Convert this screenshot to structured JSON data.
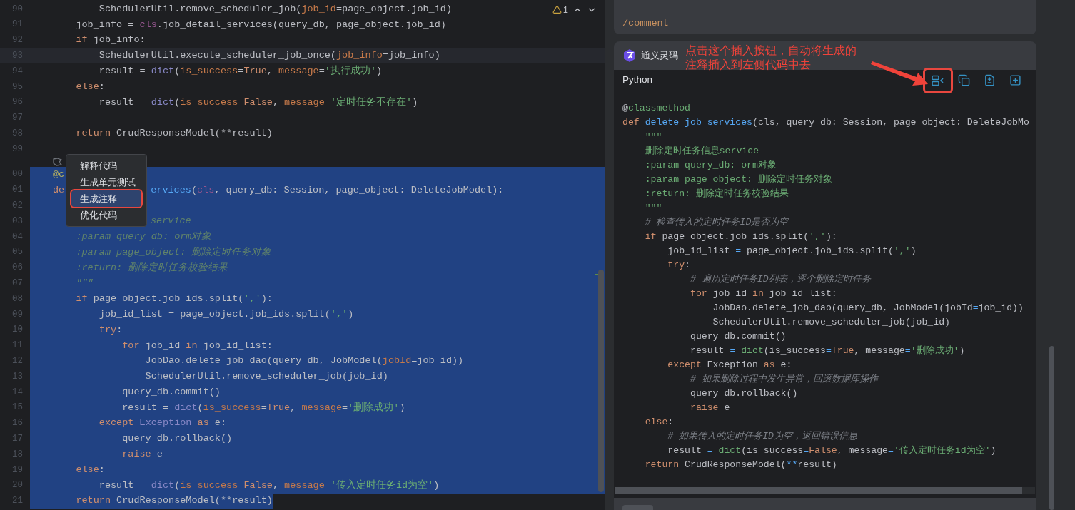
{
  "editor": {
    "warning_count": "1",
    "context_menu": {
      "items": [
        {
          "label": "解释代码",
          "selected": false,
          "annotated": false
        },
        {
          "label": "生成单元测试",
          "selected": false,
          "annotated": false
        },
        {
          "label": "生成注释",
          "selected": true,
          "annotated": true
        },
        {
          "label": "优化代码",
          "selected": false,
          "annotated": false
        }
      ]
    },
    "lines": [
      {
        "kind": "code",
        "number": "90",
        "selected": false,
        "current": false,
        "tokens": [
          {
            "text": "        SchedulerUtil.remove_scheduler_job(",
            "kind": "p"
          },
          {
            "text": "job_id",
            "kind": "kwarg"
          },
          {
            "text": "=page_object.job_id)",
            "kind": "p"
          }
        ]
      },
      {
        "kind": "code",
        "number": "91",
        "selected": false,
        "current": false,
        "tokens": [
          {
            "text": "    job_info = ",
            "kind": "p"
          },
          {
            "text": "cls",
            "kind": "self"
          },
          {
            "text": ".job_detail_services(query_db, page_object.job_id)",
            "kind": "p"
          }
        ]
      },
      {
        "kind": "code",
        "number": "92",
        "selected": false,
        "current": false,
        "tokens": [
          {
            "text": "    if",
            "kind": "kw"
          },
          {
            "text": " job_info:",
            "kind": "p"
          }
        ]
      },
      {
        "kind": "code",
        "number": "93",
        "selected": false,
        "current": true,
        "tokens": [
          {
            "text": "        SchedulerUtil.execute_scheduler_job_once(",
            "kind": "p"
          },
          {
            "text": "job_info",
            "kind": "kwarg"
          },
          {
            "text": "=job_info)",
            "kind": "p"
          }
        ]
      },
      {
        "kind": "code",
        "number": "94",
        "selected": false,
        "current": false,
        "tokens": [
          {
            "text": "        result = ",
            "kind": "p"
          },
          {
            "text": "dict",
            "kind": "bi"
          },
          {
            "text": "(",
            "kind": "p"
          },
          {
            "text": "is_success",
            "kind": "kwarg"
          },
          {
            "text": "=",
            "kind": "p"
          },
          {
            "text": "True",
            "kind": "kw"
          },
          {
            "text": ", ",
            "kind": "p"
          },
          {
            "text": "message",
            "kind": "kwarg"
          },
          {
            "text": "=",
            "kind": "p"
          },
          {
            "text": "'执行成功'",
            "kind": "str"
          },
          {
            "text": ")",
            "kind": "p"
          }
        ]
      },
      {
        "kind": "code",
        "number": "95",
        "selected": false,
        "current": false,
        "tokens": [
          {
            "text": "    else",
            "kind": "kw"
          },
          {
            "text": ":",
            "kind": "p"
          }
        ]
      },
      {
        "kind": "code",
        "number": "96",
        "selected": false,
        "current": false,
        "tokens": [
          {
            "text": "        result = ",
            "kind": "p"
          },
          {
            "text": "dict",
            "kind": "bi"
          },
          {
            "text": "(",
            "kind": "p"
          },
          {
            "text": "is_success",
            "kind": "kwarg"
          },
          {
            "text": "=",
            "kind": "p"
          },
          {
            "text": "False",
            "kind": "kw"
          },
          {
            "text": ", ",
            "kind": "p"
          },
          {
            "text": "message",
            "kind": "kwarg"
          },
          {
            "text": "=",
            "kind": "p"
          },
          {
            "text": "'定时任务不存在'",
            "kind": "str"
          },
          {
            "text": ")",
            "kind": "p"
          }
        ]
      },
      {
        "kind": "code",
        "number": "97",
        "selected": false,
        "current": false
      },
      {
        "kind": "code",
        "number": "98",
        "selected": false,
        "current": false,
        "tokens": [
          {
            "text": "    return",
            "kind": "kw"
          },
          {
            "text": " CrudResponseModel(**result)",
            "kind": "p"
          }
        ]
      },
      {
        "kind": "code",
        "number": "99",
        "selected": false,
        "current": false
      },
      {
        "kind": "inlay"
      },
      {
        "kind": "code",
        "number": "00",
        "selected": true,
        "current": false,
        "tokens": [
          {
            "text": "@c",
            "kind": "dec"
          }
        ]
      },
      {
        "kind": "code",
        "number": "01",
        "selected": true,
        "current": false,
        "tokens": [
          {
            "text": "de",
            "kind": "kw"
          }
        ],
        "tokens_after_menu": [
          {
            "text": "ervices",
            "kind": "fn"
          },
          {
            "text": "(",
            "kind": "p"
          },
          {
            "text": "cls",
            "kind": "self"
          },
          {
            "text": ", query_db: Session, page_object: DeleteJobModel):",
            "kind": "p"
          }
        ]
      },
      {
        "kind": "code",
        "number": "02",
        "selected": true,
        "current": false
      },
      {
        "kind": "code",
        "number": "03",
        "selected": true,
        "current": false,
        "tokens_after_menu": [
          {
            "text": "service",
            "kind": "doc"
          }
        ]
      },
      {
        "kind": "code",
        "number": "04",
        "selected": true,
        "current": false,
        "tokens": [
          {
            "text": "    :param query_db: orm对象",
            "kind": "doc"
          }
        ]
      },
      {
        "kind": "code",
        "number": "05",
        "selected": true,
        "current": false,
        "tokens": [
          {
            "text": "    :param page_object: 删除定时任务对象",
            "kind": "doc"
          }
        ]
      },
      {
        "kind": "code",
        "number": "06",
        "selected": true,
        "current": false,
        "tokens": [
          {
            "text": "    :return: 删除定时任务校验结果",
            "kind": "doc"
          }
        ]
      },
      {
        "kind": "code",
        "number": "07",
        "selected": true,
        "current": false,
        "tokens": [
          {
            "text": "    \"\"\"",
            "kind": "doc"
          }
        ]
      },
      {
        "kind": "code",
        "number": "08",
        "selected": true,
        "current": false,
        "tokens": [
          {
            "text": "    if",
            "kind": "kw"
          },
          {
            "text": " page_object.job_ids.split(",
            "kind": "p"
          },
          {
            "text": "','",
            "kind": "str"
          },
          {
            "text": "):",
            "kind": "p"
          }
        ]
      },
      {
        "kind": "code",
        "number": "09",
        "selected": true,
        "current": false,
        "tokens": [
          {
            "text": "        job_id_list = page_object.job_ids.split(",
            "kind": "p"
          },
          {
            "text": "','",
            "kind": "str"
          },
          {
            "text": ")",
            "kind": "p"
          }
        ]
      },
      {
        "kind": "code",
        "number": "10",
        "selected": true,
        "current": false,
        "tokens": [
          {
            "text": "        try",
            "kind": "kw"
          },
          {
            "text": ":",
            "kind": "p"
          }
        ]
      },
      {
        "kind": "code",
        "number": "11",
        "selected": true,
        "current": false,
        "tokens": [
          {
            "text": "            for",
            "kind": "kw"
          },
          {
            "text": " job_id ",
            "kind": "p"
          },
          {
            "text": "in",
            "kind": "kw"
          },
          {
            "text": " job_id_list:",
            "kind": "p"
          }
        ]
      },
      {
        "kind": "code",
        "number": "12",
        "selected": true,
        "current": false,
        "tokens": [
          {
            "text": "                JobDao.delete_job_dao(query_db, JobModel(",
            "kind": "p"
          },
          {
            "text": "jobId",
            "kind": "kwarg"
          },
          {
            "text": "=job_id))",
            "kind": "p"
          }
        ]
      },
      {
        "kind": "code",
        "number": "13",
        "selected": true,
        "current": false,
        "tokens": [
          {
            "text": "                SchedulerUtil.remove_scheduler_job(job_id)",
            "kind": "p"
          }
        ]
      },
      {
        "kind": "code",
        "number": "14",
        "selected": true,
        "current": false,
        "tokens": [
          {
            "text": "            query_db.commit()",
            "kind": "p"
          }
        ]
      },
      {
        "kind": "code",
        "number": "15",
        "selected": true,
        "current": false,
        "tokens": [
          {
            "text": "            result = ",
            "kind": "p"
          },
          {
            "text": "dict",
            "kind": "bi"
          },
          {
            "text": "(",
            "kind": "p"
          },
          {
            "text": "is_success",
            "kind": "kwarg"
          },
          {
            "text": "=",
            "kind": "p"
          },
          {
            "text": "True",
            "kind": "kw"
          },
          {
            "text": ", ",
            "kind": "p"
          },
          {
            "text": "message",
            "kind": "kwarg"
          },
          {
            "text": "=",
            "kind": "p"
          },
          {
            "text": "'删除成功'",
            "kind": "str"
          },
          {
            "text": ")",
            "kind": "p"
          }
        ]
      },
      {
        "kind": "code",
        "number": "16",
        "selected": true,
        "current": false,
        "tokens": [
          {
            "text": "        except ",
            "kind": "kw"
          },
          {
            "text": "Exception ",
            "kind": "bi"
          },
          {
            "text": "as",
            "kind": "kw"
          },
          {
            "text": " e:",
            "kind": "p"
          }
        ]
      },
      {
        "kind": "code",
        "number": "17",
        "selected": true,
        "current": false,
        "tokens": [
          {
            "text": "            query_db.rollback()",
            "kind": "p"
          }
        ]
      },
      {
        "kind": "code",
        "number": "18",
        "selected": true,
        "current": false,
        "tokens": [
          {
            "text": "            raise",
            "kind": "kw"
          },
          {
            "text": " e",
            "kind": "p"
          }
        ]
      },
      {
        "kind": "code",
        "number": "19",
        "selected": true,
        "current": false,
        "tokens": [
          {
            "text": "    else",
            "kind": "kw"
          },
          {
            "text": ":",
            "kind": "p"
          }
        ]
      },
      {
        "kind": "code",
        "number": "20",
        "selected": true,
        "current": false,
        "tokens": [
          {
            "text": "        result = ",
            "kind": "p"
          },
          {
            "text": "dict",
            "kind": "bi"
          },
          {
            "text": "(",
            "kind": "p"
          },
          {
            "text": "is_success",
            "kind": "kwarg"
          },
          {
            "text": "=",
            "kind": "p"
          },
          {
            "text": "False",
            "kind": "kw"
          },
          {
            "text": ", ",
            "kind": "p"
          },
          {
            "text": "message",
            "kind": "kwarg"
          },
          {
            "text": "=",
            "kind": "p"
          },
          {
            "text": "'传入定时任务id为空'",
            "kind": "str"
          },
          {
            "text": ")",
            "kind": "p"
          }
        ]
      },
      {
        "kind": "code",
        "number": "21",
        "selected": true,
        "current": false,
        "tokens": [
          {
            "text": "    return",
            "kind": "kw"
          },
          {
            "text": " CrudResponseModel(**result)",
            "kind": "p"
          }
        ]
      }
    ]
  },
  "assistant": {
    "command": "/comment",
    "title": "通义灵码",
    "annotation": [
      "点击这个插入按钮，自动将生成的",
      "注释插入到左侧代码中去"
    ],
    "language": "Python",
    "actions": [
      {
        "kind": "insert",
        "annotated": true
      },
      {
        "kind": "copy",
        "annotated": false
      },
      {
        "kind": "diff",
        "annotated": false
      },
      {
        "kind": "new-file",
        "annotated": false
      }
    ],
    "lines": [
      [
        {
          "text": "@",
          "kind": "p"
        },
        {
          "text": "classmethod",
          "kind": "meta"
        }
      ],
      [
        {
          "text": "def ",
          "kind": "kw"
        },
        {
          "text": "delete_job_services",
          "kind": "fn"
        },
        {
          "text": "(cls, query_db: Session, page_object: DeleteJobMo",
          "kind": "p"
        }
      ],
      [
        {
          "text": "    \"\"\"",
          "kind": "str"
        }
      ],
      [
        {
          "text": "    删除定时任务信息service",
          "kind": "str"
        }
      ],
      [
        {
          "text": "    :param query_db: orm对象",
          "kind": "str"
        }
      ],
      [
        {
          "text": "    :param page_object: 删除定时任务对象",
          "kind": "str"
        }
      ],
      [
        {
          "text": "    :return: 删除定时任务校验结果",
          "kind": "str"
        }
      ],
      [
        {
          "text": "    \"\"\"",
          "kind": "str"
        }
      ],
      [
        {
          "text": "    # 检查传入的定时任务ID是否为空",
          "kind": "cmt"
        }
      ],
      [
        {
          "text": "    if",
          "kind": "kw"
        },
        {
          "text": " page_object.job_ids.split(",
          "kind": "p"
        },
        {
          "text": "','",
          "kind": "str"
        },
        {
          "text": "):",
          "kind": "p"
        }
      ],
      [
        {
          "text": "        job_id_list ",
          "kind": "p"
        },
        {
          "text": "=",
          "kind": "op"
        },
        {
          "text": " page_object.job_ids.split(",
          "kind": "p"
        },
        {
          "text": "','",
          "kind": "str"
        },
        {
          "text": ")",
          "kind": "p"
        }
      ],
      [
        {
          "text": "        try",
          "kind": "kw"
        },
        {
          "text": ":",
          "kind": "p"
        }
      ],
      [
        {
          "text": "            # 遍历定时任务ID列表，逐个删除定时任务",
          "kind": "cmt"
        }
      ],
      [
        {
          "text": "            for",
          "kind": "kw"
        },
        {
          "text": " job_id ",
          "kind": "p"
        },
        {
          "text": "in",
          "kind": "kw"
        },
        {
          "text": " job_id_list:",
          "kind": "p"
        }
      ],
      [
        {
          "text": "                JobDao.delete_job_dao(query_db, JobModel(jobId",
          "kind": "p"
        },
        {
          "text": "=",
          "kind": "op"
        },
        {
          "text": "job_id))",
          "kind": "p"
        }
      ],
      [
        {
          "text": "                SchedulerUtil.remove_scheduler_job(job_id)",
          "kind": "p"
        }
      ],
      [
        {
          "text": "            query_db.commit()",
          "kind": "p"
        }
      ],
      [
        {
          "text": "            result ",
          "kind": "p"
        },
        {
          "text": "= ",
          "kind": "op"
        },
        {
          "text": "dict",
          "kind": "title"
        },
        {
          "text": "(is_success",
          "kind": "p"
        },
        {
          "text": "=",
          "kind": "op"
        },
        {
          "text": "True",
          "kind": "kw"
        },
        {
          "text": ", message",
          "kind": "p"
        },
        {
          "text": "=",
          "kind": "op"
        },
        {
          "text": "'删除成功'",
          "kind": "str"
        },
        {
          "text": ")",
          "kind": "p"
        }
      ],
      [
        {
          "text": "        except",
          "kind": "kw"
        },
        {
          "text": " Exception ",
          "kind": "p"
        },
        {
          "text": "as",
          "kind": "kw"
        },
        {
          "text": " e:",
          "kind": "p"
        }
      ],
      [
        {
          "text": "            # 如果删除过程中发生异常，回滚数据库操作",
          "kind": "cmt"
        }
      ],
      [
        {
          "text": "            query_db.rollback()",
          "kind": "p"
        }
      ],
      [
        {
          "text": "            raise",
          "kind": "kw"
        },
        {
          "text": " e",
          "kind": "p"
        }
      ],
      [
        {
          "text": "    else",
          "kind": "kw"
        },
        {
          "text": ":",
          "kind": "p"
        }
      ],
      [
        {
          "text": "        # 如果传入的定时任务ID为空，返回错误信息",
          "kind": "cmt"
        }
      ],
      [
        {
          "text": "        result ",
          "kind": "p"
        },
        {
          "text": "= ",
          "kind": "op"
        },
        {
          "text": "dict",
          "kind": "title"
        },
        {
          "text": "(is_success",
          "kind": "p"
        },
        {
          "text": "=",
          "kind": "op"
        },
        {
          "text": "False",
          "kind": "kw"
        },
        {
          "text": ", message",
          "kind": "p"
        },
        {
          "text": "=",
          "kind": "op"
        },
        {
          "text": "'传入定时任务id为空'",
          "kind": "str"
        },
        {
          "text": ")",
          "kind": "p"
        }
      ],
      [
        {
          "text": "    return",
          "kind": "kw"
        },
        {
          "text": " CrudResponseModel(",
          "kind": "p"
        },
        {
          "text": "**",
          "kind": "op"
        },
        {
          "text": "result)",
          "kind": "p"
        }
      ]
    ]
  }
}
